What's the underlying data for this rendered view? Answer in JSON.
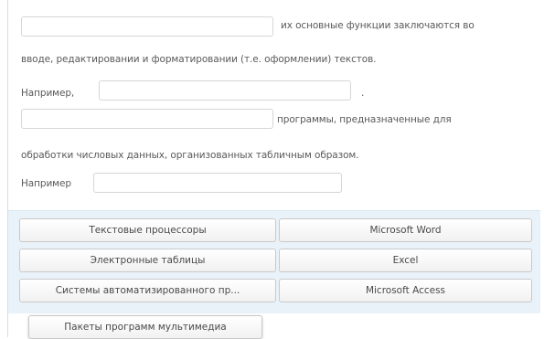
{
  "text": {
    "line1_suffix": "их основные функции заключаются во",
    "line2": "вводе, редактировании и форматировании (т.е. оформлении) текстов.",
    "line3_prefix": "Например,",
    "line3_suffix": ".",
    "line4_suffix": "программы, предназначенные для",
    "line5": "обработки числовых данных, организованных табличным образом.",
    "line6_prefix": "Например"
  },
  "blanks": [
    {
      "id": "blank-1",
      "value": ""
    },
    {
      "id": "blank-2",
      "value": ""
    },
    {
      "id": "blank-3",
      "value": ""
    },
    {
      "id": "blank-4",
      "value": ""
    }
  ],
  "options": {
    "col1": [
      "Текстовые процессоры",
      "Электронные таблицы",
      "Системы автоматизированного пр..."
    ],
    "col2": [
      "Microsoft Word",
      "Excel",
      "Microsoft Access"
    ],
    "dragging": "Пакеты программ мультимедиа"
  }
}
